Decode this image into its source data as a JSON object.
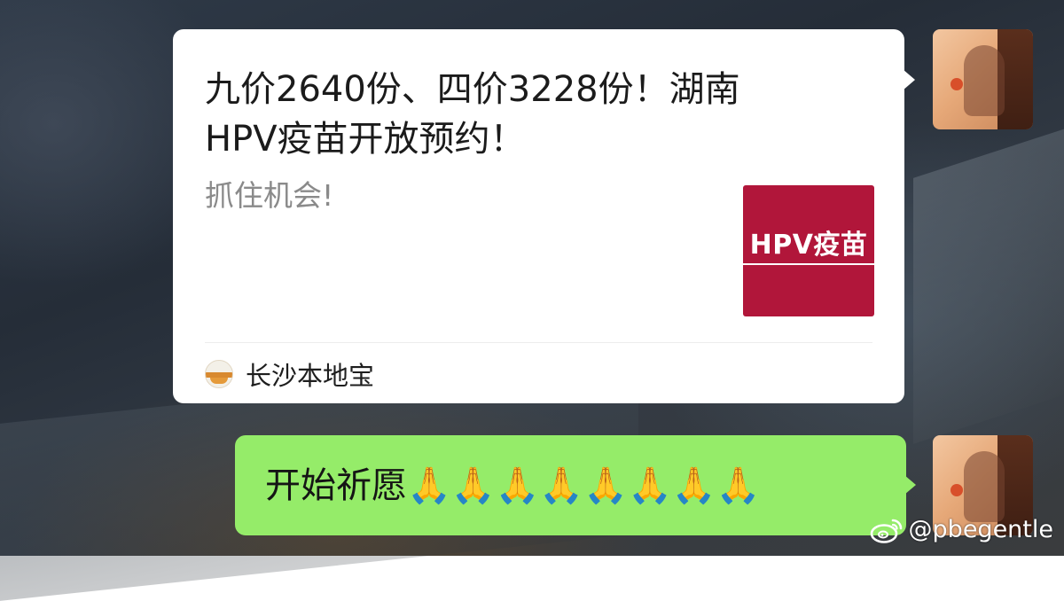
{
  "article_card": {
    "title": "九价2640份、四价3228份！湖南\nHPV疫苗开放预约！",
    "description": "抓住机会!",
    "thumbnail_text": "HPV疫苗",
    "source_name": "长沙本地宝"
  },
  "reply_message": {
    "text": "开始祈愿🙏🙏🙏🙏🙏🙏🙏🙏"
  },
  "watermark": {
    "handle": "@pbegentle"
  },
  "colors": {
    "bubble_green": "#95ec69",
    "card_white": "#ffffff",
    "thumb_red": "#b1163a"
  }
}
